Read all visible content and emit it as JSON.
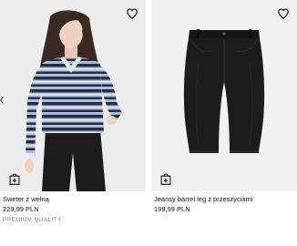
{
  "products": [
    {
      "name": "Sweter z wełną",
      "price": "229,99 PLN",
      "badge": "PREMIUM QUALITY",
      "wishlist_icon": "heart-outline-icon",
      "cart_icon": "add-to-bag-icon"
    },
    {
      "name": "Jeansy barrel leg z przeszyciami",
      "price": "199,99 PLN",
      "wishlist_icon": "heart-outline-icon",
      "cart_icon": "add-to-bag-icon"
    }
  ],
  "colors": {
    "sweater_stripe_dark": "#2b2d3b",
    "sweater_stripe_light": "#a8bde3",
    "jeans": "#1c1c1c",
    "photo_background": "#f1f1f1",
    "badge_text": "#8a8a8a"
  }
}
